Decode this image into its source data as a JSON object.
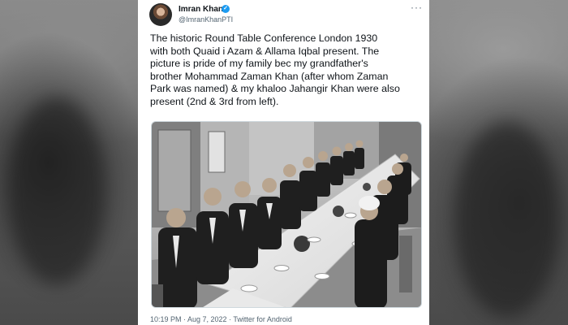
{
  "tweet": {
    "author_name": "Imran Khan",
    "handle": "@ImranKhanPTI",
    "text_lines": [
      "The historic Round Table Conference London 1930",
      "with both Quaid i Azam & Allama Iqbal present. The",
      "picture is pride of my family bec my grandfather's",
      "brother Mohammad Zaman Khan (after whom Zaman",
      "Park was named) & my khaloo Jahangir Khan were also",
      "present (2nd & 3rd from left)."
    ],
    "meta": "10:19 PM · Aug 7, 2022 · Twitter for Android"
  },
  "colors": {
    "text": "#0f1419",
    "secondary": "#536471",
    "verified": "#1d9bf0",
    "background": "#6a6a6a"
  },
  "icons": {
    "verified": "verified-badge-icon",
    "more": "more-options-icon"
  }
}
